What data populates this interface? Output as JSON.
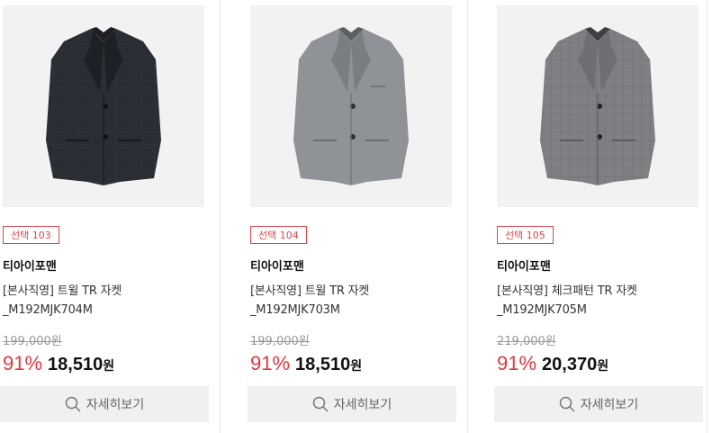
{
  "products": [
    {
      "badge": "선택 103",
      "brand": "티아이포맨",
      "name": "[본사직영] 트윌 TR 자켓_M192MJK704M",
      "original_price": "199,000원",
      "discount": "91%",
      "price": "18,510",
      "currency": "원",
      "detail_label": "자세히보기",
      "jacket_color": "#2a2d33",
      "pattern": "check"
    },
    {
      "badge": "선택 104",
      "brand": "티아이포맨",
      "name": "[본사직영] 트윌 TR 자켓_M192MJK703M",
      "original_price": "199,000원",
      "discount": "91%",
      "price": "18,510",
      "currency": "원",
      "detail_label": "자세히보기",
      "jacket_color": "#8f9296",
      "pattern": "plain"
    },
    {
      "badge": "선택 105",
      "brand": "티아이포맨",
      "name": "[본사직영] 체크패턴 TR 자켓_M192MJK705M",
      "original_price": "219,000원",
      "discount": "91%",
      "price": "20,370",
      "currency": "원",
      "detail_label": "자세히보기",
      "jacket_color": "#7f8083",
      "pattern": "check"
    }
  ],
  "colors": {
    "accent": "#e0383f",
    "button_bg": "#f0f0f0"
  }
}
